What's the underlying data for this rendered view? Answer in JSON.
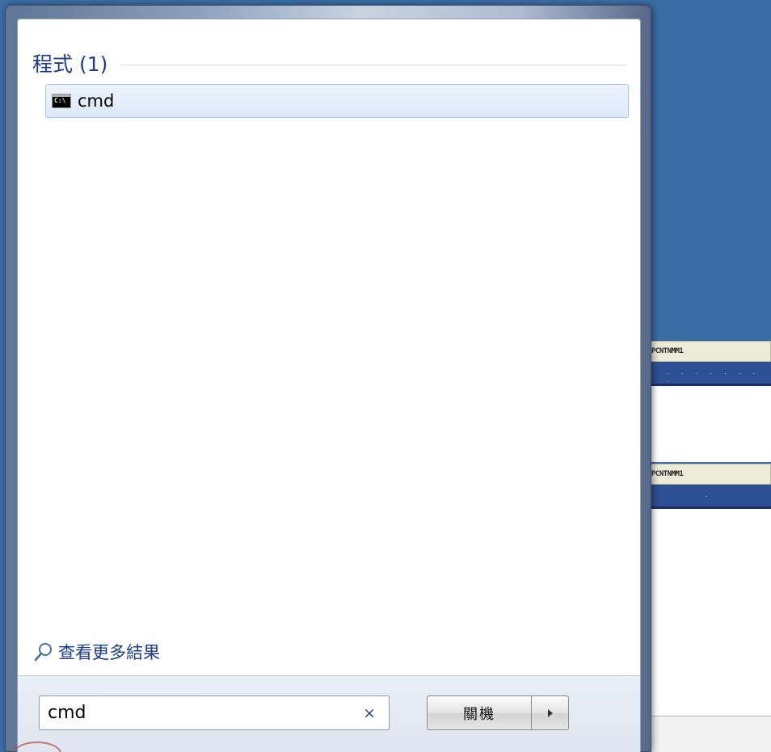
{
  "background": {
    "panel_a": {
      "title": "PCNTNMM1",
      "status_dots": ". . . . . . . ."
    },
    "panel_b": {
      "title": "PCNTNMM1",
      "status_dots": "."
    }
  },
  "start_menu": {
    "group_title": "程式 (1)",
    "results": [
      {
        "label": "cmd",
        "icon": "cmd-console-icon"
      }
    ],
    "more_results_label": "查看更多結果",
    "search": {
      "value": "cmd",
      "clear_label": "×"
    },
    "shutdown": {
      "label": "關機",
      "arrow_icon": "triangle-right-icon"
    }
  },
  "colors": {
    "desktop": "#3a6ea5",
    "group_title": "#1e3d87",
    "result_highlight": "#dbe8f8"
  }
}
